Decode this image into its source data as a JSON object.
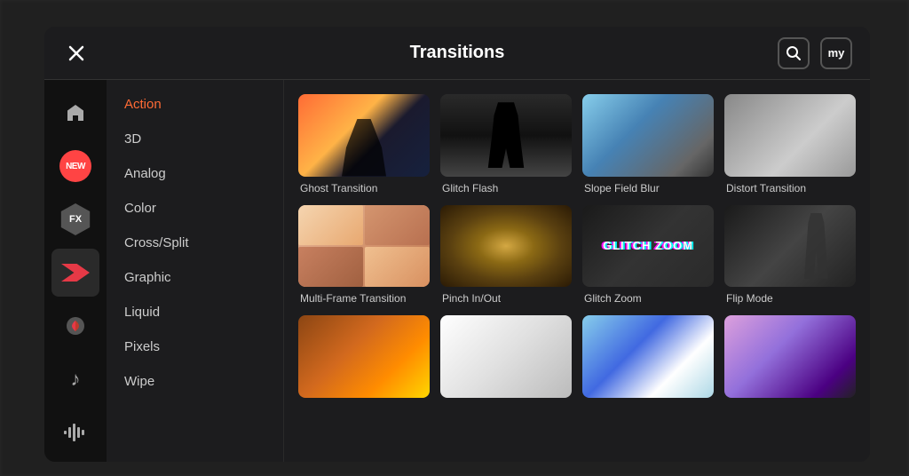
{
  "header": {
    "title": "Transitions",
    "close_label": "×",
    "search_icon": "search",
    "my_label": "my"
  },
  "sidebar": {
    "items": [
      {
        "id": "action",
        "label": "Action",
        "active": true
      },
      {
        "id": "3d",
        "label": "3D",
        "active": false
      },
      {
        "id": "analog",
        "label": "Analog",
        "active": false
      },
      {
        "id": "color",
        "label": "Color",
        "active": false
      },
      {
        "id": "cross-split",
        "label": "Cross/Split",
        "active": false
      },
      {
        "id": "graphic",
        "label": "Graphic",
        "active": false
      },
      {
        "id": "liquid",
        "label": "Liquid",
        "active": false
      },
      {
        "id": "pixels",
        "label": "Pixels",
        "active": false
      },
      {
        "id": "wipe",
        "label": "Wipe",
        "active": false
      }
    ]
  },
  "left_nav": {
    "items": [
      {
        "id": "home",
        "icon": "🏠",
        "active": false
      },
      {
        "id": "new",
        "label": "NEW",
        "active": false
      },
      {
        "id": "fx",
        "label": "FX",
        "active": false
      },
      {
        "id": "transition",
        "icon": "🎀",
        "active": true
      },
      {
        "id": "effect2",
        "icon": "❤",
        "active": false
      },
      {
        "id": "music",
        "icon": "♪",
        "active": false
      },
      {
        "id": "audio",
        "icon": "≋",
        "active": false
      }
    ]
  },
  "grid": {
    "rows": [
      [
        {
          "id": "ghost-transition",
          "label": "Ghost Transition",
          "thumb": "ghost"
        },
        {
          "id": "glitch-flash",
          "label": "Glitch Flash",
          "thumb": "glitch-flash"
        },
        {
          "id": "slope-field-blur",
          "label": "Slope Field Blur",
          "thumb": "slope"
        },
        {
          "id": "distort-transition",
          "label": "Distort Transition",
          "thumb": "distort"
        }
      ],
      [
        {
          "id": "multi-frame",
          "label": "Multi-Frame Transition",
          "thumb": "multiframe"
        },
        {
          "id": "pinch-inout",
          "label": "Pinch In/Out",
          "thumb": "pinch"
        },
        {
          "id": "glitch-zoom",
          "label": "Glitch Zoom",
          "thumb": "glitch-zoom"
        },
        {
          "id": "flip-mode",
          "label": "Flip Mode",
          "thumb": "flip"
        }
      ],
      [
        {
          "id": "row3a",
          "label": "",
          "thumb": "row3a"
        },
        {
          "id": "row3b",
          "label": "",
          "thumb": "row3b"
        },
        {
          "id": "row3c",
          "label": "",
          "thumb": "row3c"
        },
        {
          "id": "row3d",
          "label": "",
          "thumb": "row3d"
        }
      ]
    ],
    "glitch_zoom_text": "GLITCH ZOOM"
  }
}
